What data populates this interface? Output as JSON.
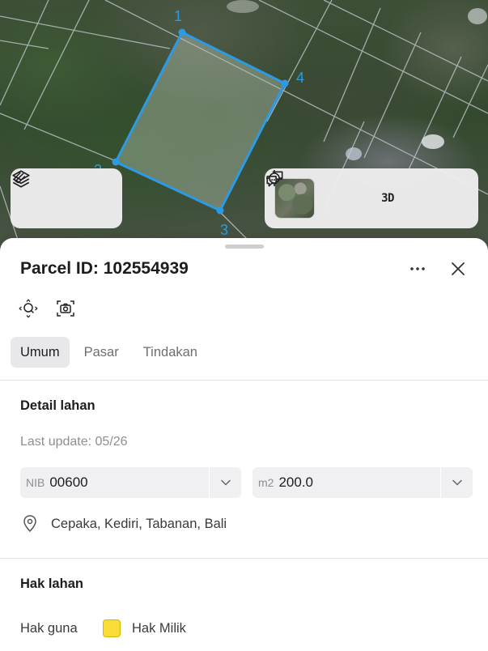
{
  "map": {
    "vertex_labels": [
      "1",
      "2",
      "3",
      "4"
    ],
    "parcel_color": "#2b9be8",
    "buttons": {
      "layers": "layers-icon",
      "draw": "draw-icon",
      "basemap": "basemap-thumbnail",
      "locate": "locate-icon",
      "view_3d_label": "3D",
      "feedback": "feedback-icon"
    }
  },
  "sheet": {
    "title": "Parcel ID: 102554939",
    "tabs": [
      {
        "label": "Umum",
        "active": true
      },
      {
        "label": "Pasar",
        "active": false
      },
      {
        "label": "Tindakan",
        "active": false
      }
    ],
    "detail": {
      "section_title": "Detail lahan",
      "last_update": "Last update: 05/26",
      "nib_label": "NIB",
      "nib_value": "00600",
      "area_label": "m2",
      "area_value": "200.0",
      "location": "Cepaka, Kediri, Tabanan, Bali"
    },
    "rights": {
      "section_title": "Hak lahan",
      "usage_label": "Hak guna",
      "usage_value": "Hak Milik",
      "usage_color": "#f7dc3a"
    }
  }
}
